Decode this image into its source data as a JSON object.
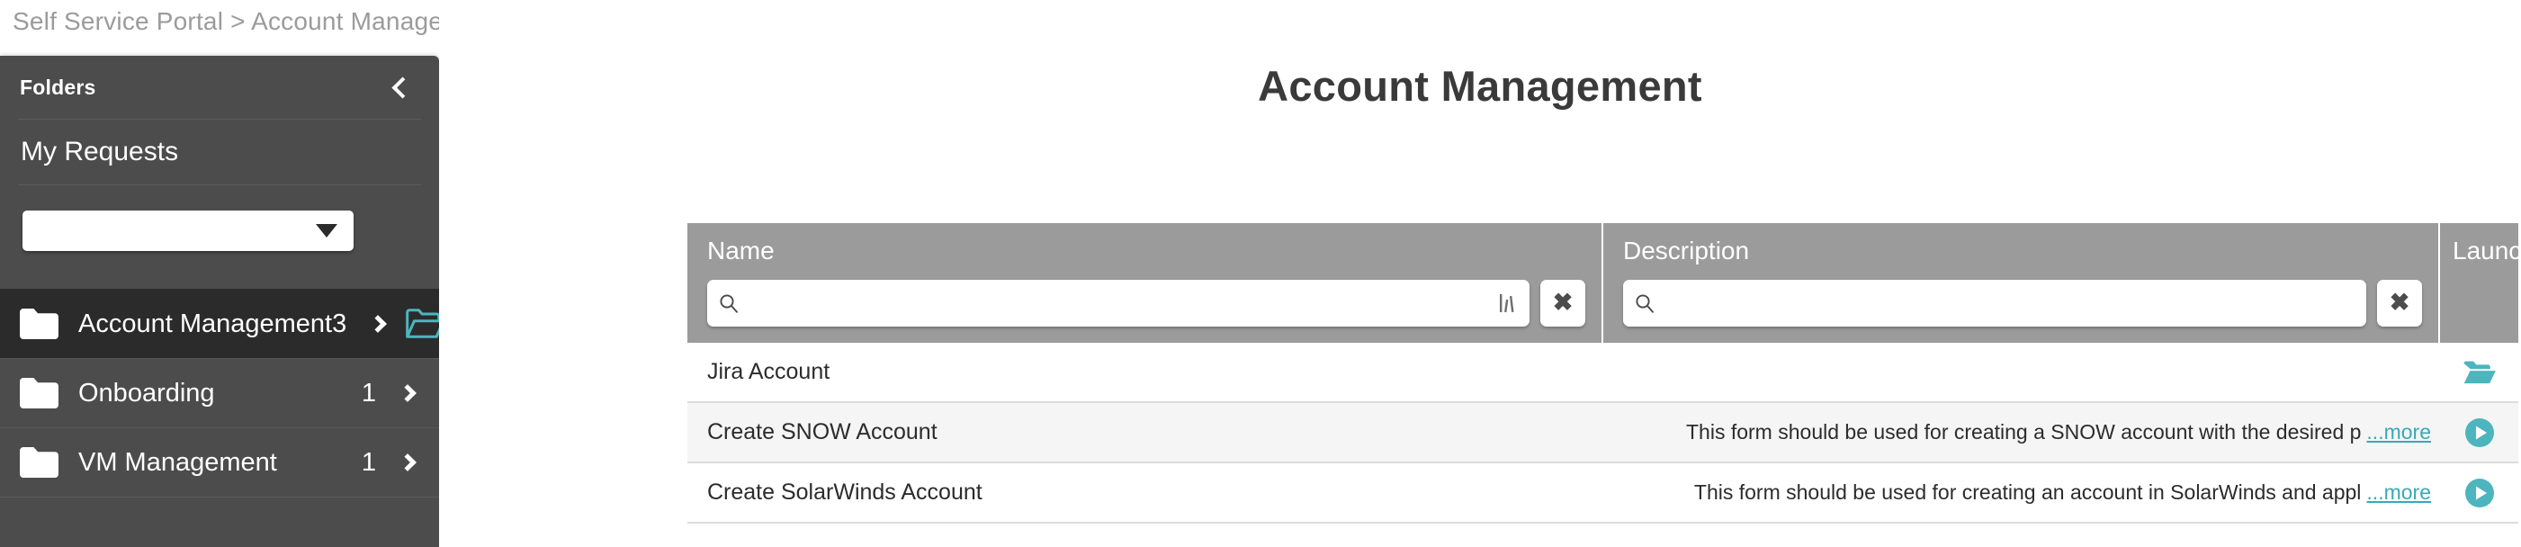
{
  "breadcrumb": {
    "text": "Self Service Portal > Account Management"
  },
  "sidebar": {
    "header_title": "Folders",
    "collapse_icon": "chevron-left-icon",
    "my_requests_label": "My Requests",
    "folder_select": {
      "value": "",
      "placeholder": "",
      "caret_icon": "chevron-down-icon"
    },
    "items": [
      {
        "label": "Account Management",
        "count": "3",
        "active": true,
        "folder_icon": "folder-icon",
        "chevron_icon": "chevron-right-icon",
        "open_folder_icon": "open-folder-icon"
      },
      {
        "label": "Onboarding",
        "count": "1",
        "active": false,
        "folder_icon": "folder-icon",
        "chevron_icon": "chevron-right-icon",
        "open_folder_icon": ""
      },
      {
        "label": "VM Management",
        "count": "1",
        "active": false,
        "folder_icon": "folder-icon",
        "chevron_icon": "chevron-right-icon",
        "open_folder_icon": ""
      }
    ]
  },
  "main": {
    "page_title": "Account Management",
    "table": {
      "columns": [
        {
          "key": "name",
          "label": "Name"
        },
        {
          "key": "description",
          "label": "Description"
        },
        {
          "key": "launch",
          "label": "Launch"
        }
      ],
      "filters": {
        "name": {
          "value": "",
          "placeholder": "",
          "search_icon": "search-icon",
          "sort_icon": "sort-bars-icon",
          "clear_label": "✖"
        },
        "description": {
          "value": "",
          "placeholder": "",
          "search_icon": "search-icon",
          "clear_label": "✖"
        }
      },
      "rows": [
        {
          "name": "Jira Account",
          "description": "",
          "more_label": "",
          "launch_icon": "open-folder-icon"
        },
        {
          "name": "Create SNOW Account",
          "description": "This form should be used for creating a SNOW account with the desired p",
          "more_label": "...more",
          "launch_icon": "play-circle-icon"
        },
        {
          "name": "Create SolarWinds Account",
          "description": "This form should be used for creating an account in SolarWinds and appl",
          "more_label": "...more",
          "launch_icon": "play-circle-icon"
        }
      ]
    }
  },
  "colors": {
    "sidebar_bg": "#4c4c4c",
    "sidebar_active_bg": "#2b2b2b",
    "table_header_bg": "#9b9b9b",
    "accent_teal": "#4cb5bd",
    "link_teal": "#3aa9b5",
    "title_color": "#3a3a3a",
    "breadcrumb_color": "#9b9b9b",
    "row_alt_bg": "#f5f5f5"
  }
}
